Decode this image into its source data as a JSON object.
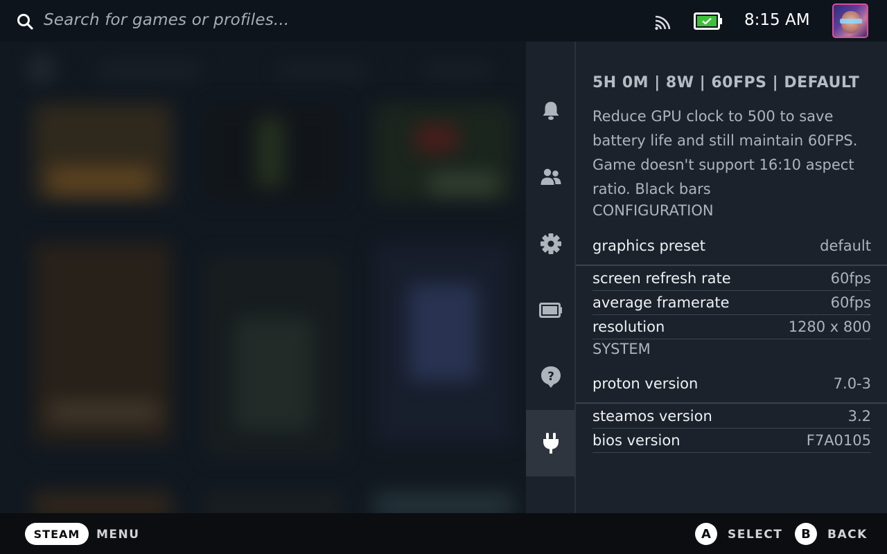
{
  "search": {
    "placeholder": "Search for games or profiles..."
  },
  "status": {
    "time": "8:15 AM"
  },
  "nav": {
    "items": [
      {
        "name": "notifications",
        "icon": "bell-icon"
      },
      {
        "name": "friends",
        "icon": "friends-icon"
      },
      {
        "name": "settings",
        "icon": "gear-icon"
      },
      {
        "name": "performance",
        "icon": "battery-icon"
      },
      {
        "name": "help",
        "icon": "question-icon"
      },
      {
        "name": "plugins",
        "icon": "plug-icon",
        "active": true
      }
    ]
  },
  "panel": {
    "summary": "5H 0M | 8W | 60FPS | DEFAULT",
    "description": "Reduce GPU clock to 500 to save battery life and still maintain 60FPS. Game doesn't support 16:10 aspect ratio. Black bars",
    "config_header": "CONFIGURATION",
    "config": [
      {
        "key": "graphics preset",
        "value": "default"
      },
      {
        "key": "screen refresh rate",
        "value": "60fps"
      },
      {
        "key": "average framerate",
        "value": "60fps"
      },
      {
        "key": "resolution",
        "value": "1280 x 800"
      }
    ],
    "system_header": "SYSTEM",
    "system": [
      {
        "key": "proton version",
        "value": "7.0-3"
      },
      {
        "key": "steamos version",
        "value": "3.2"
      },
      {
        "key": "bios version",
        "value": "F7A0105"
      }
    ]
  },
  "footer": {
    "steam_label": "STEAM",
    "menu_label": "MENU",
    "a_glyph": "A",
    "select_label": "SELECT",
    "b_glyph": "B",
    "back_label": "BACK"
  },
  "colors": {
    "accent_battery": "#3ec03a",
    "avatar_border": "#e04c9d",
    "panel_bg": "#1b222b"
  }
}
